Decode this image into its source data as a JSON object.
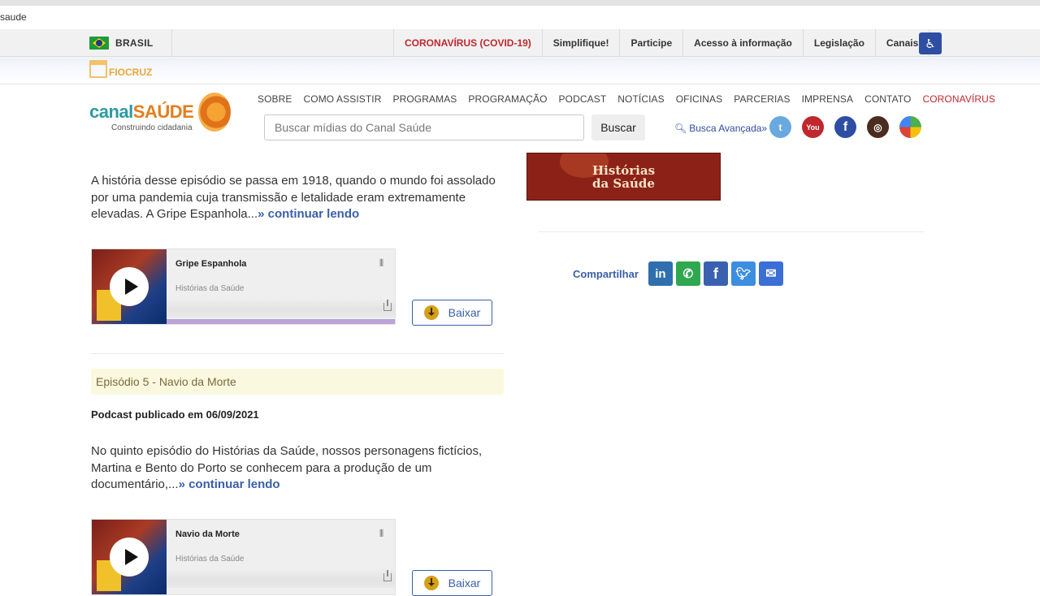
{
  "browser": {
    "url_fragment": "saude"
  },
  "govbar": {
    "country": "BRASIL",
    "links": [
      {
        "label": "CORONAVÍRUS (COVID-19)",
        "color": "#c0282d"
      },
      {
        "label": "Simplifique!"
      },
      {
        "label": "Participe"
      },
      {
        "label": "Acesso à informação"
      },
      {
        "label": "Legislação"
      },
      {
        "label": "Canais"
      }
    ]
  },
  "fiocruz": {
    "label": "FIOCRUZ"
  },
  "header": {
    "logo": {
      "word_a": "canal",
      "word_b": "SAÚDE",
      "tagline": "Construindo cidadania"
    },
    "nav": [
      "SOBRE",
      "COMO ASSISTIR",
      "PROGRAMAS",
      "PROGRAMAÇÃO",
      "PODCAST",
      "NOTÍCIAS",
      "OFICINAS",
      "PARCERIAS",
      "IMPRENSA",
      "CONTATO",
      "CORONAVÍRUS"
    ],
    "search": {
      "placeholder": "Buscar mídias do Canal Saúde",
      "button": "Buscar"
    },
    "advanced_search": "Busca Avançada»",
    "social": [
      "twitter-icon",
      "youtube-icon",
      "facebook-icon",
      "instagram-icon",
      "maps-icon"
    ],
    "youtube_label": "You"
  },
  "episode4": {
    "text": "A história desse episódio se passa em 1918, quando o mundo foi assolado por uma pandemia cuja transmissão e letalidade eram extremamente elevadas. A Gripe Espanhola...",
    "more": "» continuar lendo",
    "player": {
      "title": "Gripe Espanhola",
      "subtitle": "Histórias da Saúde",
      "progress": 1.0
    },
    "download": "Baixar"
  },
  "episode5": {
    "title": "Episódio 5 - Navio da Morte",
    "published": "Podcast publicado em 06/09/2021",
    "text": "No quinto episódio do Histórias da Saúde, nossos personagens fictícios, Martina e Bento do Porto se conhecem para a produção de um documentário,...",
    "more": "» continuar lendo",
    "player": {
      "title": "Navio da Morte",
      "subtitle": "Histórias da Saúde"
    },
    "download": "Baixar"
  },
  "sidebar": {
    "banner_line1": "Histórias",
    "banner_line2": "da Saúde",
    "share_label": "Compartilhar",
    "share_buttons": [
      "linkedin-icon",
      "whatsapp-icon",
      "facebook-icon",
      "twitter-icon",
      "email-icon"
    ]
  }
}
